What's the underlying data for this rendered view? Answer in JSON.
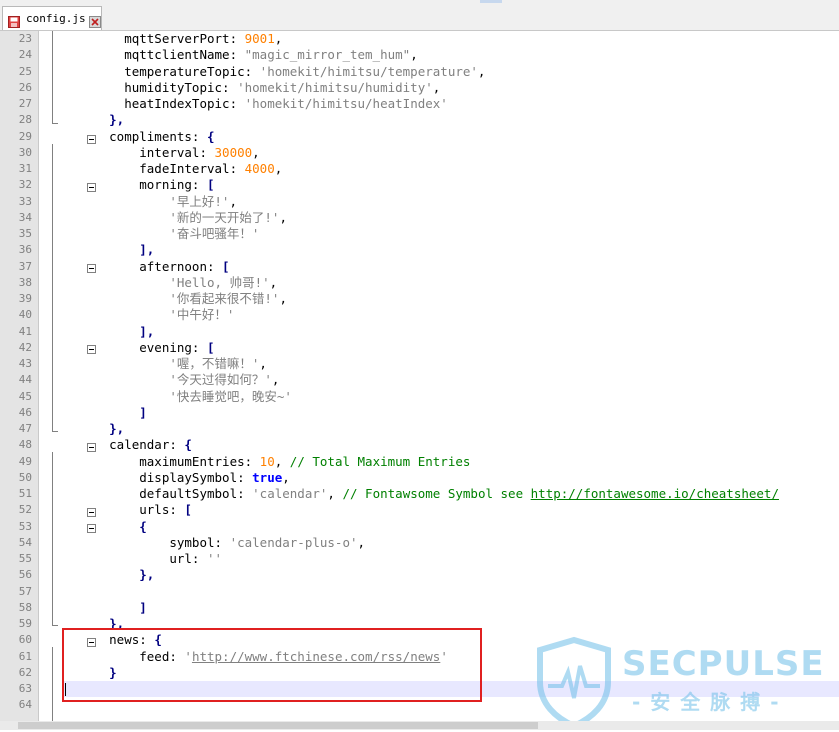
{
  "tab": {
    "title": "config.js"
  },
  "lines": [
    {
      "n": "23",
      "parts": [
        [
          "        mqttServerPort: ",
          ""
        ],
        [
          "9001",
          "num"
        ],
        [
          ",",
          ""
        ]
      ]
    },
    {
      "n": "24",
      "parts": [
        [
          "        mqttclientName: ",
          ""
        ],
        [
          "\"magic_mirror_tem_hum\"",
          "str"
        ],
        [
          ",",
          ""
        ]
      ]
    },
    {
      "n": "25",
      "parts": [
        [
          "        temperatureTopic: ",
          ""
        ],
        [
          "'homekit/himitsu/temperature'",
          "str"
        ],
        [
          ",",
          ""
        ]
      ]
    },
    {
      "n": "26",
      "parts": [
        [
          "        humidityTopic: ",
          ""
        ],
        [
          "'homekit/himitsu/humidity'",
          "str"
        ],
        [
          ",",
          ""
        ]
      ]
    },
    {
      "n": "27",
      "parts": [
        [
          "        heatIndexTopic: ",
          ""
        ],
        [
          "'homekit/himitsu/heatIndex'",
          "str"
        ]
      ]
    },
    {
      "n": "28",
      "parts": [
        [
          "      ",
          ""
        ],
        [
          "},",
          "op"
        ]
      ]
    },
    {
      "n": "29",
      "parts": [
        [
          "      compliments: ",
          ""
        ],
        [
          "{",
          "op"
        ]
      ]
    },
    {
      "n": "30",
      "parts": [
        [
          "          interval: ",
          ""
        ],
        [
          "30000",
          "num"
        ],
        [
          ",",
          ""
        ]
      ]
    },
    {
      "n": "31",
      "parts": [
        [
          "          fadeInterval: ",
          ""
        ],
        [
          "4000",
          "num"
        ],
        [
          ",",
          ""
        ]
      ]
    },
    {
      "n": "32",
      "parts": [
        [
          "          morning: ",
          ""
        ],
        [
          "[",
          "op"
        ]
      ]
    },
    {
      "n": "33",
      "parts": [
        [
          "              ",
          ""
        ],
        [
          "'早上好!'",
          "str"
        ],
        [
          ",",
          ""
        ]
      ]
    },
    {
      "n": "34",
      "parts": [
        [
          "              ",
          ""
        ],
        [
          "'新的一天开始了!'",
          "str"
        ],
        [
          ",",
          ""
        ]
      ]
    },
    {
      "n": "35",
      "parts": [
        [
          "              ",
          ""
        ],
        [
          "'奋斗吧骚年！'",
          "str"
        ]
      ]
    },
    {
      "n": "36",
      "parts": [
        [
          "          ",
          ""
        ],
        [
          "],",
          "op"
        ]
      ]
    },
    {
      "n": "37",
      "parts": [
        [
          "          afternoon: ",
          ""
        ],
        [
          "[",
          "op"
        ]
      ]
    },
    {
      "n": "38",
      "parts": [
        [
          "              ",
          ""
        ],
        [
          "'Hello, 帅哥!'",
          "str"
        ],
        [
          ",",
          ""
        ]
      ]
    },
    {
      "n": "39",
      "parts": [
        [
          "              ",
          ""
        ],
        [
          "'你看起来很不错!'",
          "str"
        ],
        [
          ",",
          ""
        ]
      ]
    },
    {
      "n": "40",
      "parts": [
        [
          "              ",
          ""
        ],
        [
          "'中午好！'",
          "str"
        ]
      ]
    },
    {
      "n": "41",
      "parts": [
        [
          "          ",
          ""
        ],
        [
          "],",
          "op"
        ]
      ]
    },
    {
      "n": "42",
      "parts": [
        [
          "          evening: ",
          ""
        ],
        [
          "[",
          "op"
        ]
      ]
    },
    {
      "n": "43",
      "parts": [
        [
          "              ",
          ""
        ],
        [
          "'喔，不错嘛！'",
          "str"
        ],
        [
          ",",
          ""
        ]
      ]
    },
    {
      "n": "44",
      "parts": [
        [
          "              ",
          ""
        ],
        [
          "'今天过得如何？'",
          "str"
        ],
        [
          ",",
          ""
        ]
      ]
    },
    {
      "n": "45",
      "parts": [
        [
          "              ",
          ""
        ],
        [
          "'快去睡觉吧，晚安~'",
          "str"
        ]
      ]
    },
    {
      "n": "46",
      "parts": [
        [
          "          ",
          ""
        ],
        [
          "]",
          "op"
        ]
      ]
    },
    {
      "n": "47",
      "parts": [
        [
          "      ",
          ""
        ],
        [
          "},",
          "op"
        ]
      ]
    },
    {
      "n": "48",
      "parts": [
        [
          "      calendar: ",
          ""
        ],
        [
          "{",
          "op"
        ]
      ]
    },
    {
      "n": "49",
      "parts": [
        [
          "          maximumEntries: ",
          ""
        ],
        [
          "10",
          "num"
        ],
        [
          ", ",
          ""
        ],
        [
          "// Total Maximum Entries",
          "cmt"
        ]
      ]
    },
    {
      "n": "50",
      "parts": [
        [
          "          displaySymbol: ",
          ""
        ],
        [
          "true",
          "kw"
        ],
        [
          ",",
          ""
        ]
      ]
    },
    {
      "n": "51",
      "parts": [
        [
          "          defaultSymbol: ",
          ""
        ],
        [
          "'calendar'",
          "str"
        ],
        [
          ", ",
          ""
        ],
        [
          "// Fontawsome Symbol see ",
          "cmt"
        ],
        [
          "http://fontawesome.io/cheatsheet/",
          "url"
        ]
      ]
    },
    {
      "n": "52",
      "parts": [
        [
          "          urls: ",
          ""
        ],
        [
          "[",
          "op"
        ]
      ]
    },
    {
      "n": "53",
      "parts": [
        [
          "          ",
          ""
        ],
        [
          "{",
          "op"
        ]
      ]
    },
    {
      "n": "54",
      "parts": [
        [
          "              symbol: ",
          ""
        ],
        [
          "'calendar-plus-o'",
          "str"
        ],
        [
          ",",
          ""
        ]
      ]
    },
    {
      "n": "55",
      "parts": [
        [
          "              url: ",
          ""
        ],
        [
          "''",
          "str"
        ]
      ]
    },
    {
      "n": "56",
      "parts": [
        [
          "          ",
          ""
        ],
        [
          "},",
          "op"
        ]
      ]
    },
    {
      "n": "57",
      "parts": [
        [
          "",
          ""
        ]
      ]
    },
    {
      "n": "58",
      "parts": [
        [
          "          ",
          ""
        ],
        [
          "]",
          "op"
        ]
      ]
    },
    {
      "n": "59",
      "parts": [
        [
          "      ",
          ""
        ],
        [
          "},",
          "op"
        ]
      ]
    },
    {
      "n": "60",
      "parts": [
        [
          "      news: ",
          ""
        ],
        [
          "{",
          "op"
        ]
      ]
    },
    {
      "n": "61",
      "parts": [
        [
          "          feed: ",
          ""
        ],
        [
          "'",
          "str"
        ],
        [
          "http://www.ftchinese.com/rss/news",
          "strurl"
        ],
        [
          "'",
          "str"
        ]
      ]
    },
    {
      "n": "62",
      "parts": [
        [
          "      ",
          ""
        ],
        [
          "}",
          "op"
        ]
      ]
    },
    {
      "n": "63",
      "parts": [
        [
          "",
          ""
        ]
      ],
      "current": true
    },
    {
      "n": "64",
      "parts": [
        [
          "",
          ""
        ]
      ]
    }
  ],
  "watermark": {
    "brand": "SECPULSE",
    "sub": "-安全脉搏-"
  },
  "colors": {
    "number": "#ff8000",
    "string": "#808080",
    "keyword": "#0000ff",
    "comment": "#008000",
    "highlight": "#e02020"
  }
}
